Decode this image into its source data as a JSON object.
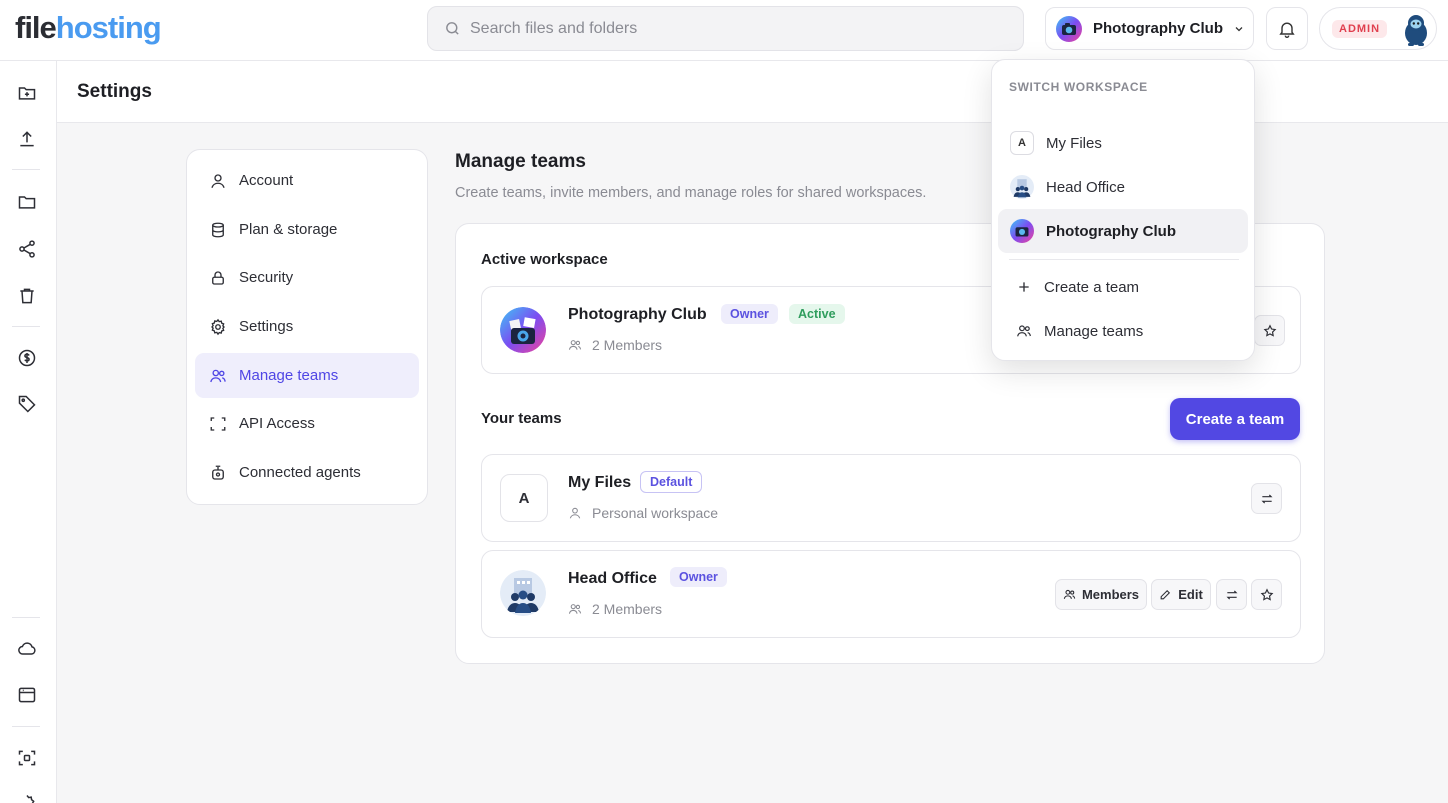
{
  "app": {
    "logo_part1": "file",
    "logo_part2": "hosting"
  },
  "search": {
    "placeholder": "Search files and folders",
    "value": ""
  },
  "header": {
    "workspace_name": "Photography Club",
    "admin_badge": "ADMIN"
  },
  "page": {
    "title": "Settings"
  },
  "settings_nav": {
    "items": [
      {
        "label": "Account",
        "icon": "user-icon"
      },
      {
        "label": "Plan & storage",
        "icon": "database-icon"
      },
      {
        "label": "Security",
        "icon": "lock-icon"
      },
      {
        "label": "Settings",
        "icon": "gear-icon"
      },
      {
        "label": "Manage teams",
        "icon": "users-icon",
        "active": true
      },
      {
        "label": "API Access",
        "icon": "scan-icon"
      },
      {
        "label": "Connected agents",
        "icon": "robot-icon"
      }
    ]
  },
  "content": {
    "title": "Manage teams",
    "subtitle": "Create teams, invite members, and manage roles for shared workspaces.",
    "active_section": "Active workspace",
    "teams_section": "Your teams",
    "create_button": "Create a team",
    "active_workspace": {
      "name": "Photography Club",
      "badges": [
        "Owner",
        "Active"
      ],
      "meta": "2 Members"
    },
    "teams": [
      {
        "name": "My Files",
        "initial": "A",
        "badge": "Default",
        "meta": "Personal workspace"
      },
      {
        "name": "Head Office",
        "badge": "Owner",
        "meta": "2 Members",
        "actions": {
          "members": "Members",
          "edit": "Edit"
        }
      }
    ]
  },
  "dropdown": {
    "header": "SWITCH WORKSPACE",
    "workspaces": [
      {
        "label": "My Files",
        "initial": "A"
      },
      {
        "label": "Head Office"
      },
      {
        "label": "Photography Club",
        "selected": true
      }
    ],
    "actions": [
      {
        "label": "Create a team",
        "icon": "plus-icon"
      },
      {
        "label": "Manage teams",
        "icon": "users-icon"
      }
    ]
  },
  "colors": {
    "accent": "#5248e3",
    "logo_blue": "#4a9bf0",
    "owner_badge": "#5b52e0",
    "active_badge": "#2f9d5d",
    "admin_badge": "#e0404f"
  }
}
